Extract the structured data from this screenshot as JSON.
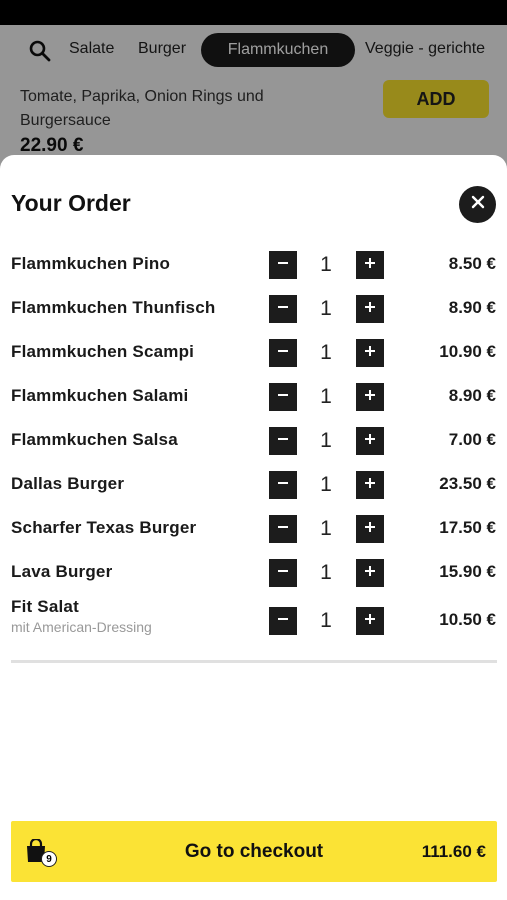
{
  "categories": {
    "items": [
      "Salate",
      "Burger"
    ],
    "active": "Flammkuchen",
    "next": "Veggie - gerichte"
  },
  "background_item": {
    "description": "Tomate, Paprika, Onion Rings und Burgersauce",
    "price": "22.90 €",
    "add_label": "ADD"
  },
  "order": {
    "title": "Your Order",
    "items": [
      {
        "name": "Flammkuchen Pino",
        "qty": "1",
        "price": "8.50 €"
      },
      {
        "name": "Flammkuchen Thunfisch",
        "qty": "1",
        "price": "8.90 €"
      },
      {
        "name": "Flammkuchen Scampi",
        "qty": "1",
        "price": "10.90 €"
      },
      {
        "name": "Flammkuchen Salami",
        "qty": "1",
        "price": "8.90 €"
      },
      {
        "name": "Flammkuchen Salsa",
        "qty": "1",
        "price": "7.00 €"
      },
      {
        "name": "Dallas Burger",
        "qty": "1",
        "price": "23.50 €"
      },
      {
        "name": "Scharfer Texas Burger",
        "qty": "1",
        "price": "17.50 €"
      },
      {
        "name": "Lava Burger",
        "qty": "1",
        "price": "15.90 €"
      },
      {
        "name": "Fit Salat",
        "sub": "mit American-Dressing",
        "qty": "1",
        "price": "10.50 €"
      }
    ]
  },
  "checkout": {
    "label": "Go to checkout",
    "count": "9",
    "total": "111.60 €"
  },
  "icons": {
    "search": "search-icon",
    "close": "close-icon",
    "minus": "minus-icon",
    "plus": "plus-icon",
    "bag": "shopping-bag-icon"
  },
  "colors": {
    "accent": "#fbe335",
    "dark": "#1c1c1c"
  }
}
